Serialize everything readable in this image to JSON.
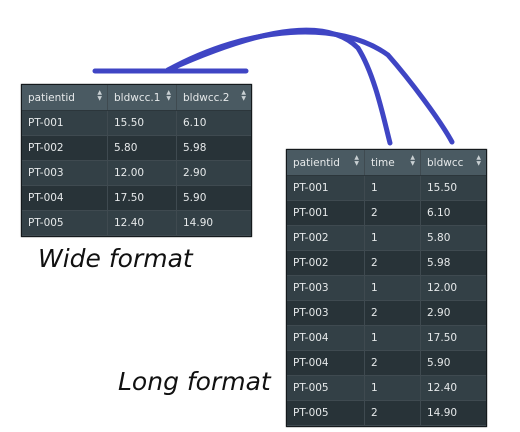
{
  "wide": {
    "caption": "Wide format",
    "columns": [
      "patientid",
      "bldwcc.1",
      "bldwcc.2"
    ],
    "rows": [
      [
        "PT-001",
        "15.50",
        "6.10"
      ],
      [
        "PT-002",
        "5.80",
        "5.98"
      ],
      [
        "PT-003",
        "12.00",
        "2.90"
      ],
      [
        "PT-004",
        "17.50",
        "5.90"
      ],
      [
        "PT-005",
        "12.40",
        "14.90"
      ]
    ]
  },
  "long": {
    "caption": "Long format",
    "columns": [
      "patientid",
      "time",
      "bldwcc"
    ],
    "rows": [
      [
        "PT-001",
        "1",
        "15.50"
      ],
      [
        "PT-001",
        "2",
        "6.10"
      ],
      [
        "PT-002",
        "1",
        "5.80"
      ],
      [
        "PT-002",
        "2",
        "5.98"
      ],
      [
        "PT-003",
        "1",
        "12.00"
      ],
      [
        "PT-003",
        "2",
        "2.90"
      ],
      [
        "PT-004",
        "1",
        "17.50"
      ],
      [
        "PT-004",
        "2",
        "5.90"
      ],
      [
        "PT-005",
        "1",
        "12.40"
      ],
      [
        "PT-005",
        "2",
        "14.90"
      ]
    ]
  },
  "colors": {
    "arrow": "#3f45c4",
    "table_header": "#4a5a62",
    "table_row": "#334046",
    "table_row_alt": "#283338"
  },
  "icons": {
    "sort": "sort-arrows-icon"
  }
}
